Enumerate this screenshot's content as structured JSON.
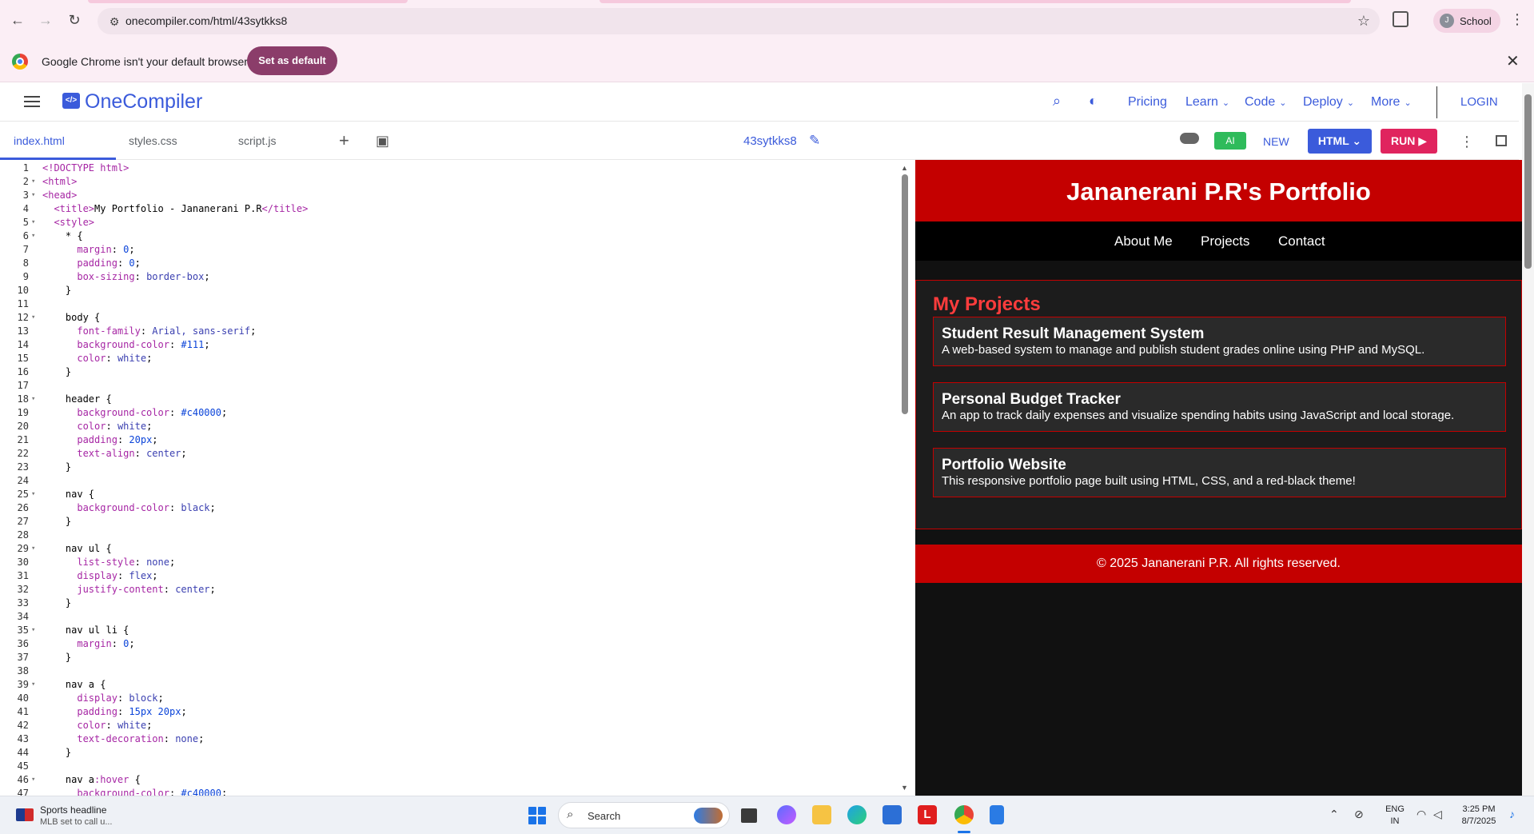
{
  "browser": {
    "url": "onecompiler.com/html/43sytkks8",
    "profile_initial": "J",
    "profile_name": "School"
  },
  "infobar": {
    "message": "Google Chrome isn't your default browser",
    "button": "Set as default"
  },
  "site_header": {
    "brand": "OneCompiler",
    "nav": [
      {
        "label": "Pricing",
        "has_menu": false
      },
      {
        "label": "Learn",
        "has_menu": true
      },
      {
        "label": "Code",
        "has_menu": true
      },
      {
        "label": "Deploy",
        "has_menu": true
      },
      {
        "label": "More",
        "has_menu": true
      }
    ],
    "login": "LOGIN"
  },
  "editor_toolbar": {
    "tabs": [
      "index.html",
      "styles.css",
      "script.js"
    ],
    "active_tab": "index.html",
    "project_name": "43sytkks8",
    "ai_label": "AI",
    "new_label": "NEW",
    "language": "HTML",
    "run_label": "RUN"
  },
  "code": [
    "<!DOCTYPE html>",
    "<html>",
    "<head>",
    "  <title>My Portfolio - Jananerani P.R</title>",
    "  <style>",
    "    * {",
    "      margin: 0;",
    "      padding: 0;",
    "      box-sizing: border-box;",
    "    }",
    "",
    "    body {",
    "      font-family: Arial, sans-serif;",
    "      background-color: #111;",
    "      color: white;",
    "    }",
    "",
    "    header {",
    "      background-color: #c40000;",
    "      color: white;",
    "      padding: 20px;",
    "      text-align: center;",
    "    }",
    "",
    "    nav {",
    "      background-color: black;",
    "    }",
    "",
    "    nav ul {",
    "      list-style: none;",
    "      display: flex;",
    "      justify-content: center;",
    "    }",
    "",
    "    nav ul li {",
    "      margin: 0;",
    "    }",
    "",
    "    nav a {",
    "      display: block;",
    "      padding: 15px 20px;",
    "      color: white;",
    "      text-decoration: none;",
    "    }",
    "",
    "    nav a:hover {",
    "      background-color: #c40000;"
  ],
  "preview": {
    "title": "Jananerani P.R's Portfolio",
    "nav": [
      "About Me",
      "Projects",
      "Contact"
    ],
    "section_heading": "My Projects",
    "projects": [
      {
        "title": "Student Result Management System",
        "desc": "A web-based system to manage and publish student grades online using PHP and MySQL."
      },
      {
        "title": "Personal Budget Tracker",
        "desc": "An app to track daily expenses and visualize spending habits using JavaScript and local storage."
      },
      {
        "title": "Portfolio Website",
        "desc": "This responsive portfolio page built using HTML, CSS, and a red-black theme!"
      }
    ],
    "footer": "© 2025 Jananerani P.R. All rights reserved.",
    "colors": {
      "header": "#c40000",
      "background": "#111111",
      "heading": "#ff3c3c"
    }
  },
  "taskbar": {
    "news_title": "Sports headline",
    "news_sub": "MLB set to call u...",
    "search_label": "Search",
    "lang_top": "ENG",
    "lang_bottom": "IN",
    "time": "3:25 PM",
    "date": "8/7/2025"
  }
}
